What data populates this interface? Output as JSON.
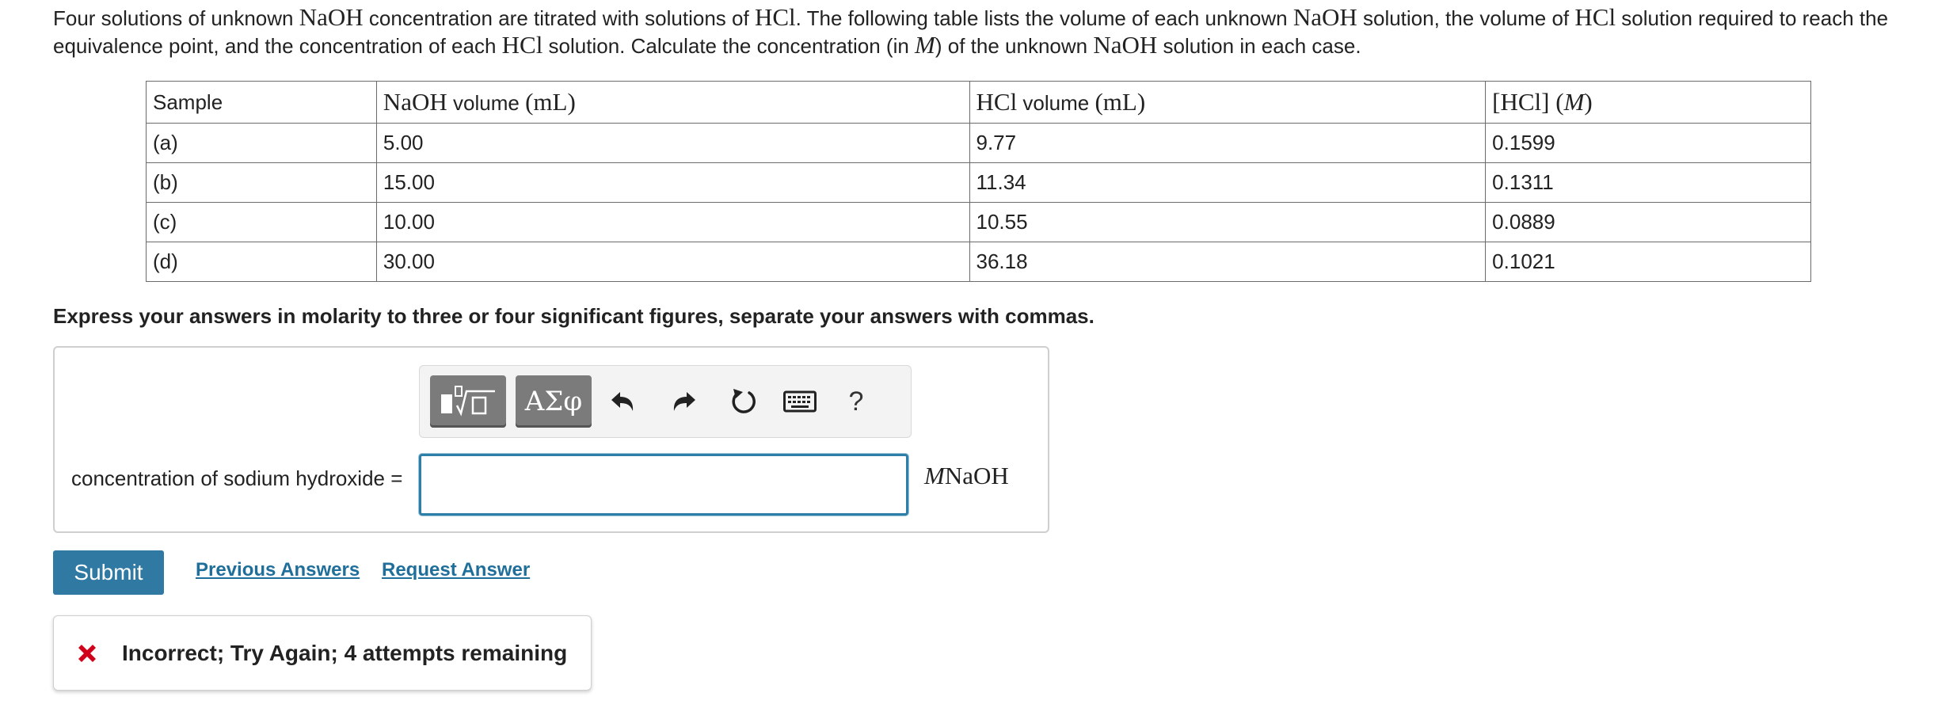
{
  "prompt": {
    "p1": "Four solutions of unknown ",
    "m1": "NaOH",
    "p2": " concentration are titrated with solutions of ",
    "m2": "HCl",
    "p3": ". The following table lists the volume of each unknown ",
    "m3": "NaOH",
    "p4": " solution, the volume of ",
    "m4": "HCl",
    "p5": " solution required to reach the equivalence point, and the concentration of each ",
    "m5": "HCl",
    "p6": " solution. Calculate the concentration (in ",
    "m6": "M",
    "p7": ") of the unknown ",
    "m7": "NaOH",
    "p8": " solution in each case."
  },
  "table": {
    "headers": {
      "sample": "Sample",
      "naoh_math": "NaOH",
      "naoh_text": " volume ",
      "naoh_unit": "(mL)",
      "hcl_math": "HCl",
      "hcl_text": " volume ",
      "hcl_unit": "(mL)",
      "conc_math": "[HCl]",
      "conc_open": " (",
      "conc_unit": "M",
      "conc_close": ")"
    },
    "rows": [
      {
        "sample": "(a)",
        "naoh": "5.00",
        "hcl": "9.77",
        "conc": "0.1599"
      },
      {
        "sample": "(b)",
        "naoh": "15.00",
        "hcl": "11.34",
        "conc": "0.1311"
      },
      {
        "sample": "(c)",
        "naoh": "10.00",
        "hcl": "10.55",
        "conc": "0.0889"
      },
      {
        "sample": "(d)",
        "naoh": "30.00",
        "hcl": "36.18",
        "conc": "0.1021"
      }
    ]
  },
  "instructions": "Express your answers in molarity to three or four significant figures, separate your answers with commas.",
  "answer": {
    "toolbar": {
      "greek_label": "ΑΣφ",
      "help_label": "?",
      "icons": [
        "templates-icon",
        "greek-letters-icon",
        "undo-icon",
        "redo-icon",
        "reset-icon",
        "keyboard-icon",
        "help-icon"
      ]
    },
    "label": "concentration of sodium hydroxide =",
    "value": "",
    "unit_italic": "M",
    "unit_text": "NaOH"
  },
  "actions": {
    "submit": "Submit",
    "previous_answers": "Previous Answers",
    "request_answer": "Request Answer"
  },
  "feedback": {
    "text": "Incorrect; Try Again; 4 attempts remaining",
    "icon": "x-mark-icon"
  },
  "colors": {
    "submit_bg": "#2f79a3",
    "link": "#1f6f9a",
    "input_border": "#2d7fa7",
    "error_red": "#d0021b",
    "toolbar_button": "#7b7b7b"
  }
}
